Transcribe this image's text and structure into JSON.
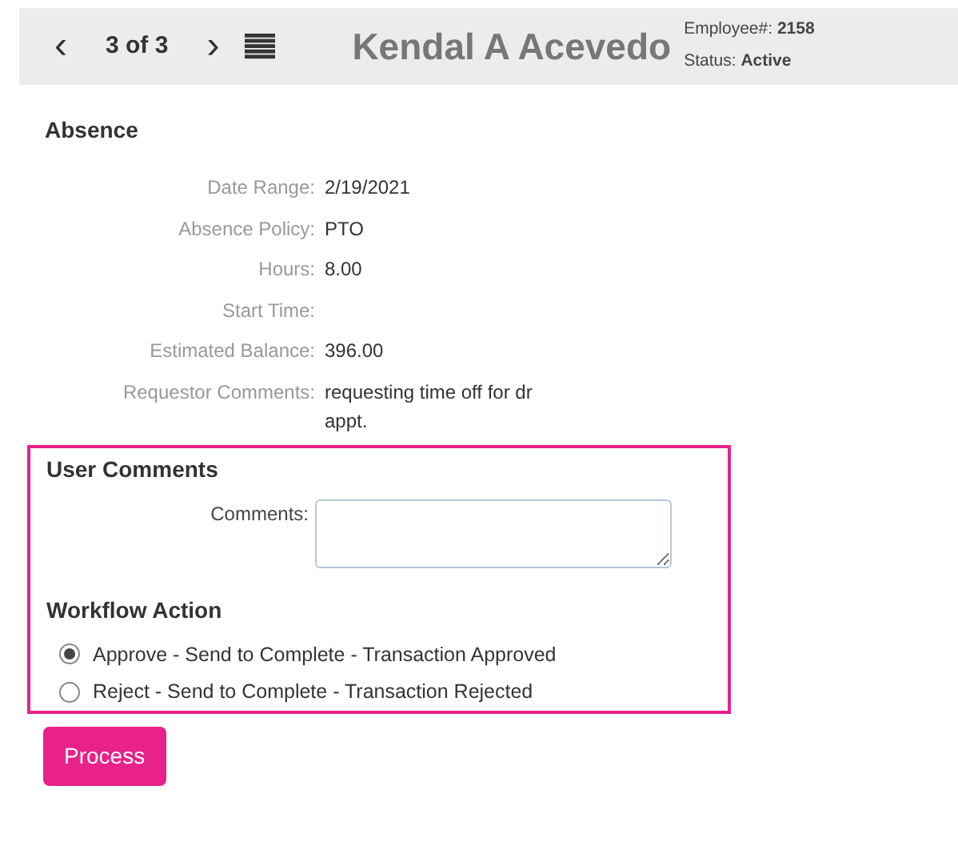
{
  "header": {
    "prev": "‹",
    "position": "3 of 3",
    "next": "›",
    "name": "Kendal A Acevedo",
    "employee_label": "Employee#:",
    "employee_number": "2158",
    "status_label": "Status:",
    "status": "Active"
  },
  "absence": {
    "title": "Absence",
    "fields": [
      {
        "label": "Date Range:",
        "value": "2/19/2021"
      },
      {
        "label": "Absence Policy:",
        "value": "PTO"
      },
      {
        "label": "Hours:",
        "value": "8.00"
      },
      {
        "label": "Start Time:"
      },
      {
        "label": "Estimated Balance:",
        "value": "396.00"
      },
      {
        "label": "Requestor Comments:",
        "value": "requesting time off for dr appt."
      }
    ]
  },
  "user_comments": {
    "title": "User Comments",
    "label": "Comments:"
  },
  "workflow_action": {
    "title": "Workflow Action",
    "options": [
      {
        "label": "Approve - Send to Complete - Transaction Approved",
        "selected": true
      },
      {
        "label": "Reject - Send to Complete - Transaction Rejected",
        "selected": false
      }
    ]
  },
  "button": "Process"
}
